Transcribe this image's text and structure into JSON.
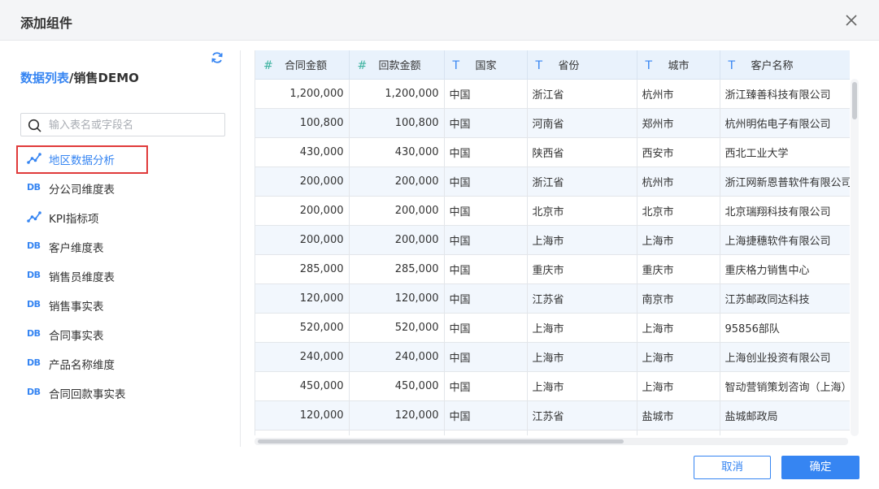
{
  "dialog": {
    "title": "添加组件"
  },
  "breadcrumb": {
    "part1": "数据列表",
    "separator": "/",
    "part2": "销售DEMO"
  },
  "search": {
    "placeholder": "输入表名或字段名",
    "value": ""
  },
  "tables": [
    {
      "label": "地区数据分析",
      "icon": "analysis-icon",
      "selected": true
    },
    {
      "label": "分公司维度表",
      "icon": "DB",
      "selected": false
    },
    {
      "label": "KPI指标项",
      "icon": "analysis-icon",
      "selected": false
    },
    {
      "label": "客户维度表",
      "icon": "DB",
      "selected": false
    },
    {
      "label": "销售员维度表",
      "icon": "DB",
      "selected": false
    },
    {
      "label": "销售事实表",
      "icon": "DB",
      "selected": false
    },
    {
      "label": "合同事实表",
      "icon": "DB",
      "selected": false
    },
    {
      "label": "产品名称维度",
      "icon": "DB",
      "selected": false
    },
    {
      "label": "合同回款事实表",
      "icon": "DB",
      "selected": false
    }
  ],
  "columns": [
    {
      "type": "#",
      "name": "合同金额"
    },
    {
      "type": "#",
      "name": "回款金额"
    },
    {
      "type": "T",
      "name": "国家"
    },
    {
      "type": "T",
      "name": "省份"
    },
    {
      "type": "T",
      "name": "城市"
    },
    {
      "type": "T",
      "name": "客户名称"
    }
  ],
  "rows": [
    [
      "1,200,000",
      "1,200,000",
      "中国",
      "浙江省",
      "杭州市",
      "浙江臻善科技有限公司"
    ],
    [
      "100,800",
      "100,800",
      "中国",
      "河南省",
      "郑州市",
      "杭州明佑电子有限公司"
    ],
    [
      "430,000",
      "430,000",
      "中国",
      "陕西省",
      "西安市",
      "西北工业大学"
    ],
    [
      "200,000",
      "200,000",
      "中国",
      "浙江省",
      "杭州市",
      "浙江网新恩普软件有限公司"
    ],
    [
      "200,000",
      "200,000",
      "中国",
      "北京市",
      "北京市",
      "北京瑞翔科技有限公司"
    ],
    [
      "200,000",
      "200,000",
      "中国",
      "上海市",
      "上海市",
      "上海捷穗软件有限公司"
    ],
    [
      "285,000",
      "285,000",
      "中国",
      "重庆市",
      "重庆市",
      "重庆格力销售中心"
    ],
    [
      "120,000",
      "120,000",
      "中国",
      "江苏省",
      "南京市",
      "江苏邮政同达科技"
    ],
    [
      "520,000",
      "520,000",
      "中国",
      "上海市",
      "上海市",
      "95856部队"
    ],
    [
      "240,000",
      "240,000",
      "中国",
      "上海市",
      "上海市",
      "上海创业投资有限公司"
    ],
    [
      "450,000",
      "450,000",
      "中国",
      "上海市",
      "上海市",
      "智动营销策划咨询（上海）"
    ],
    [
      "120,000",
      "120,000",
      "中国",
      "江苏省",
      "盐城市",
      "盐城邮政局"
    ],
    [
      "",
      "",
      "",
      "",
      "",
      ""
    ]
  ],
  "buttons": {
    "cancel": "取消",
    "ok": "确定"
  },
  "colors": {
    "accent": "#3685f2",
    "selection_border": "#e03a3a",
    "header_bg": "#e9f2fc"
  }
}
